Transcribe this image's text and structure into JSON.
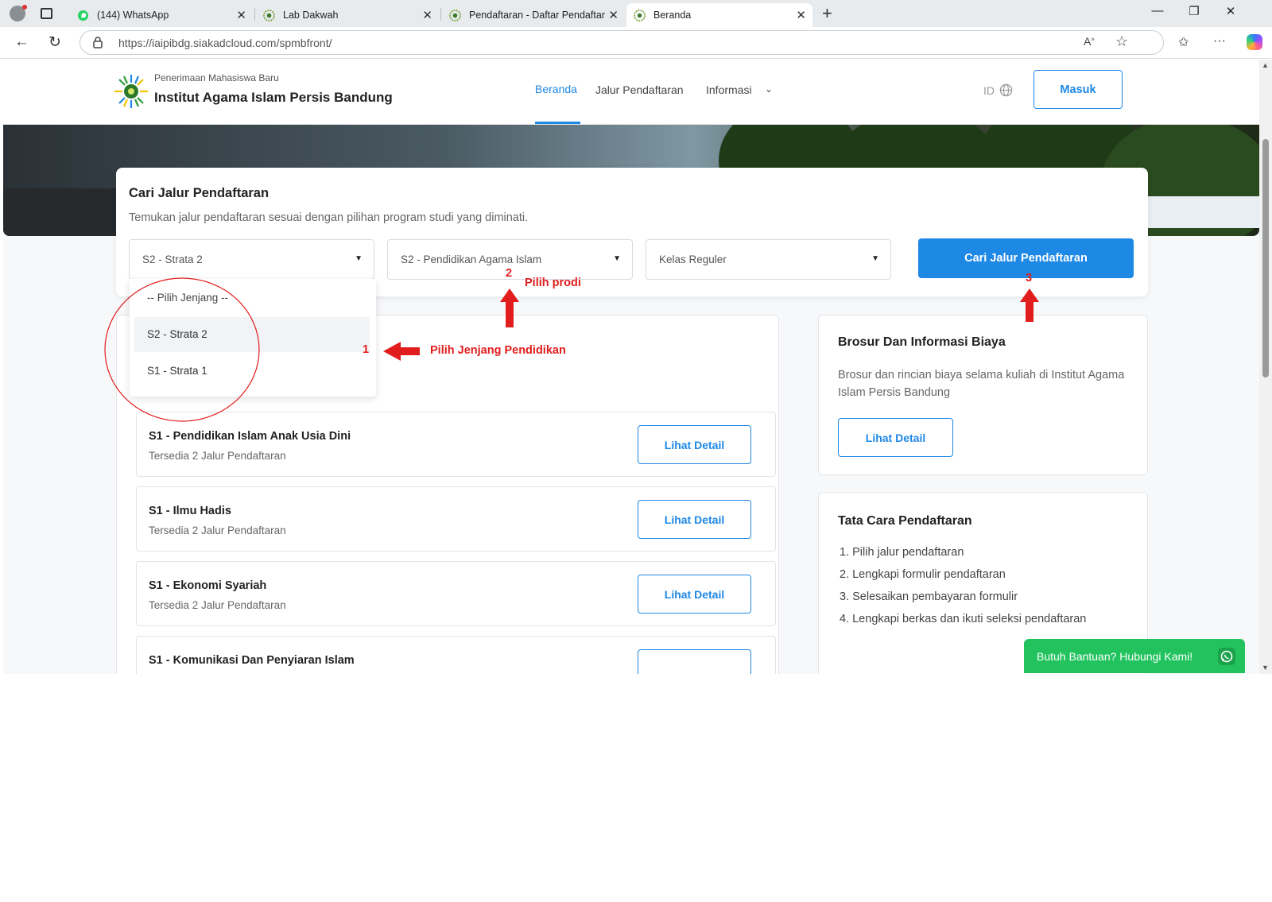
{
  "browser": {
    "tabs": [
      {
        "title": "(144) WhatsApp",
        "icon": "whatsapp-icon"
      },
      {
        "title": "Lab Dakwah",
        "icon": "site-logo-icon"
      },
      {
        "title": "Pendaftaran - Daftar Pendaftar",
        "icon": "site-logo-icon"
      },
      {
        "title": "Beranda",
        "icon": "site-logo-icon"
      }
    ],
    "url": "https://iaipibdg.siakadcloud.com/spmbfront/"
  },
  "header": {
    "subtitle": "Penerimaan Mahasiswa Baru",
    "title": "Institut Agama Islam Persis Bandung",
    "nav": [
      "Beranda",
      "Jalur Pendaftaran",
      "Informasi"
    ],
    "lang": "ID",
    "login": "Masuk",
    "accent": "#1e88e5"
  },
  "search": {
    "title": "Cari Jalur Pendaftaran",
    "desc": "Temukan jalur pendaftaran sesuai dengan pilihan program studi yang diminati.",
    "jenjang": "S2 - Strata 2",
    "prodi": "S2 - Pendidikan Agama Islam",
    "kelas": "Kelas Reguler",
    "button": "Cari Jalur Pendaftaran",
    "dropdown": [
      "-- Pilih Jenjang --",
      "S2 - Strata 2",
      "S1 - Strata 1"
    ]
  },
  "prodi_list": [
    {
      "name": "S1 - Pendidikan Islam Anak Usia Dini",
      "info": "Tersedia 2 Jalur Pendaftaran",
      "btn": "Lihat Detail"
    },
    {
      "name": "S1 - Ilmu Hadis",
      "info": "Tersedia 2 Jalur Pendaftaran",
      "btn": "Lihat Detail"
    },
    {
      "name": "S1 - Ekonomi Syariah",
      "info": "Tersedia 2 Jalur Pendaftaran",
      "btn": "Lihat Detail"
    },
    {
      "name": "S1 - Komunikasi Dan Penyiaran Islam",
      "info": "",
      "btn": ""
    }
  ],
  "brosur": {
    "title": "Brosur Dan Informasi Biaya",
    "desc": "Brosur dan rincian biaya selama kuliah di Institut Agama Islam Persis Bandung",
    "btn": "Lihat Detail"
  },
  "tatacara": {
    "title": "Tata Cara Pendaftaran",
    "steps": [
      "1. Pilih jalur pendaftaran",
      "2. Lengkapi formulir pendaftaran",
      "3. Selesaikan pembayaran formulir",
      "4. Lengkapi berkas dan ikuti seleksi pendaftaran"
    ]
  },
  "annotations": {
    "n1": "1",
    "label1": "Pilih Jenjang Pendidikan",
    "n2": "2",
    "label2": "Pilih prodi",
    "n3": "3",
    "color": "#e11d1d"
  },
  "whatsapp": {
    "label": "Butuh Bantuan? Hubungi Kami!",
    "color": "#22c35e"
  }
}
